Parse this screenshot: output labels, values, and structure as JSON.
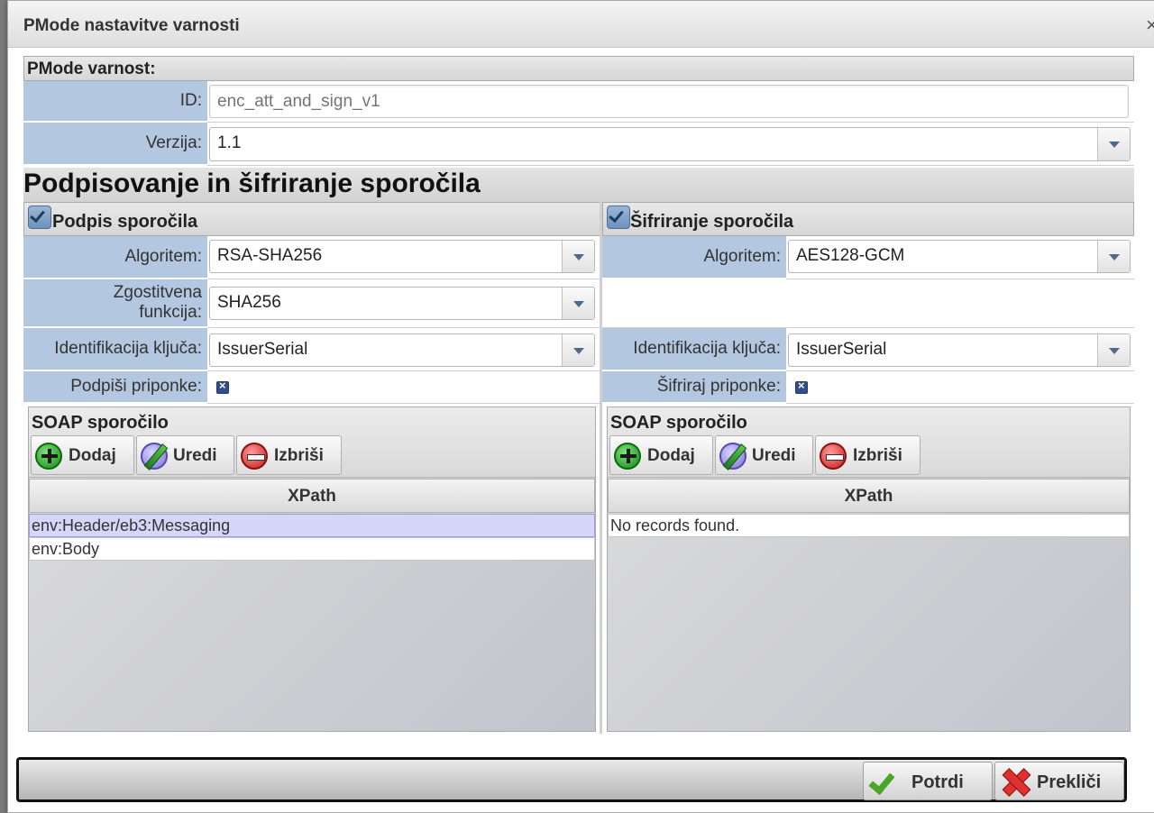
{
  "dialog": {
    "title": "PMode nastavitve varnosti",
    "close_glyph": "×"
  },
  "security": {
    "header": "PMode varnost:",
    "id_label": "ID:",
    "id_placeholder": "enc_att_and_sign_v1",
    "id_value": "",
    "version_label": "Verzija:",
    "version_value": "1.1"
  },
  "section": {
    "title": "Podpisovanje in šifriranje sporočila"
  },
  "signature": {
    "checked": true,
    "header": "Podpis sporočila",
    "algorithm_label": "Algoritem:",
    "algorithm_value": "RSA-SHA256",
    "hash_label": "Zgostitvena funkcija:",
    "hash_value": "SHA256",
    "key_id_label": "Identifikacija ključa:",
    "key_id_value": "IssuerSerial",
    "attachments_label": "Podpiši priponke:",
    "soap_title": "SOAP sporočilo",
    "btn_add": "Dodaj",
    "btn_edit": "Uredi",
    "btn_delete": "Izbriši",
    "column_header": "XPath",
    "rows": [
      "env:Header/eb3:Messaging",
      "env:Body"
    ]
  },
  "encryption": {
    "checked": true,
    "header": "Šifriranje sporočila",
    "algorithm_label": "Algoritem:",
    "algorithm_value": "AES128-GCM",
    "key_id_label": "Identifikacija ključa:",
    "key_id_value": "IssuerSerial",
    "attachments_label": "Šifriraj priponke:",
    "soap_title": "SOAP sporočilo",
    "btn_add": "Dodaj",
    "btn_edit": "Uredi",
    "btn_delete": "Izbriši",
    "column_header": "XPath",
    "empty_text": "No records found."
  },
  "footer": {
    "confirm": "Potrdi",
    "cancel": "Prekliči"
  }
}
